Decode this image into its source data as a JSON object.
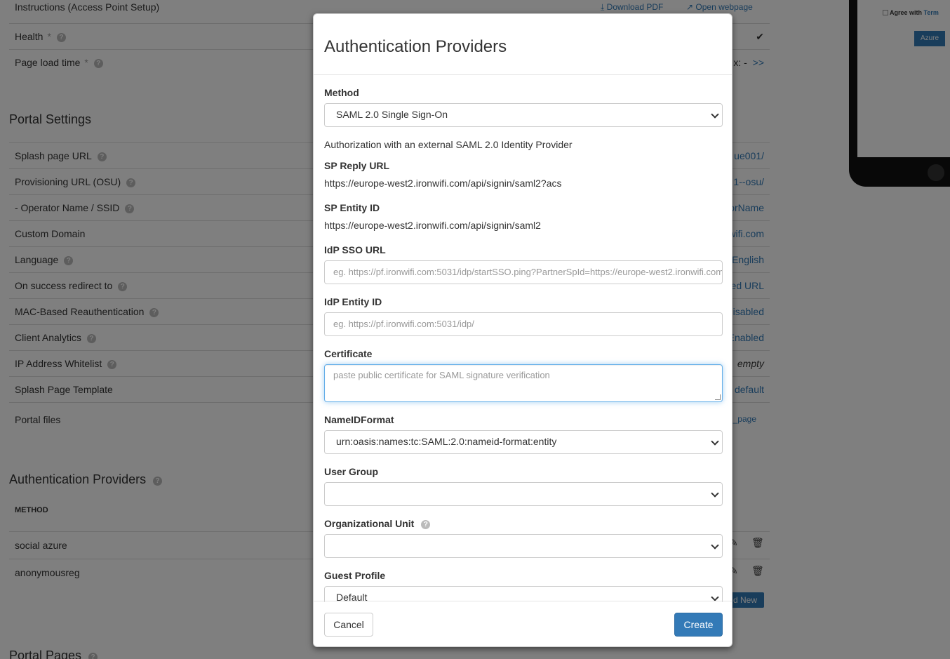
{
  "background": {
    "instructions_label": "Instructions (Access Point Setup)",
    "download_pdf": "Download PDF",
    "open_webpage": "Open webpage",
    "health_label": "Health",
    "page_load_label": "Page load time",
    "page_load_value": "x: -",
    "page_load_link": ">>",
    "portal_settings_title": "Portal Settings",
    "settings": [
      {
        "label": "Splash page URL",
        "value": "ue001/"
      },
      {
        "label": "Provisioning URL (OSU)",
        "value": "1--osu/"
      },
      {
        "label": "-  Operator Name / SSID",
        "value": "orName"
      },
      {
        "label": "Custom Domain",
        "value": "wifi.com"
      },
      {
        "label": "Language",
        "value": "English"
      },
      {
        "label": "On success redirect to",
        "value": "ed URL"
      },
      {
        "label": "MAC-Based Reauthentication",
        "value": "isabled"
      },
      {
        "label": "Client Analytics",
        "value": "Enabled"
      },
      {
        "label": "IP Address Whitelist",
        "value": "empty"
      },
      {
        "label": "Splash Page Template",
        "value": "default"
      },
      {
        "label": "Portal files",
        "value": "_page"
      }
    ],
    "auth_providers_title": "Authentication Providers",
    "method_header": "METHOD",
    "providers": [
      "social azure",
      "anonymousreg"
    ],
    "add_new": "d New",
    "portal_pages_title": "Portal Pages",
    "phone_agree": "Agree with",
    "phone_terms": "Term",
    "phone_azure": "Azure"
  },
  "modal": {
    "title": "Authentication Providers",
    "method_label": "Method",
    "method_value": "SAML 2.0 Single Sign-On",
    "method_description": "Authorization with an external SAML 2.0 Identity Provider",
    "sp_reply_label": "SP Reply URL",
    "sp_reply_value": "https://europe-west2.ironwifi.com/api/signin/saml2?acs",
    "sp_entity_label": "SP Entity ID",
    "sp_entity_value": "https://europe-west2.ironwifi.com/api/signin/saml2",
    "idp_sso_label": "IdP SSO URL",
    "idp_sso_placeholder": "eg. https://pf.ironwifi.com:5031/idp/startSSO.ping?PartnerSpId=https://europe-west2.ironwifi.com",
    "idp_entity_label": "IdP Entity ID",
    "idp_entity_placeholder": "eg. https://pf.ironwifi.com:5031/idp/",
    "certificate_label": "Certificate",
    "certificate_placeholder": "paste public certificate for SAML signature verification",
    "nameid_label": "NameIDFormat",
    "nameid_value": "urn:oasis:names:tc:SAML:2.0:nameid-format:entity",
    "user_group_label": "User Group",
    "user_group_value": "",
    "org_unit_label": "Organizational Unit",
    "org_unit_value": "",
    "guest_profile_label": "Guest Profile",
    "guest_profile_value": "Default",
    "cancel_label": "Cancel",
    "create_label": "Create"
  },
  "colors": {
    "primary": "#337ab7",
    "overlay": "rgba(0,0,0,0.5)"
  }
}
